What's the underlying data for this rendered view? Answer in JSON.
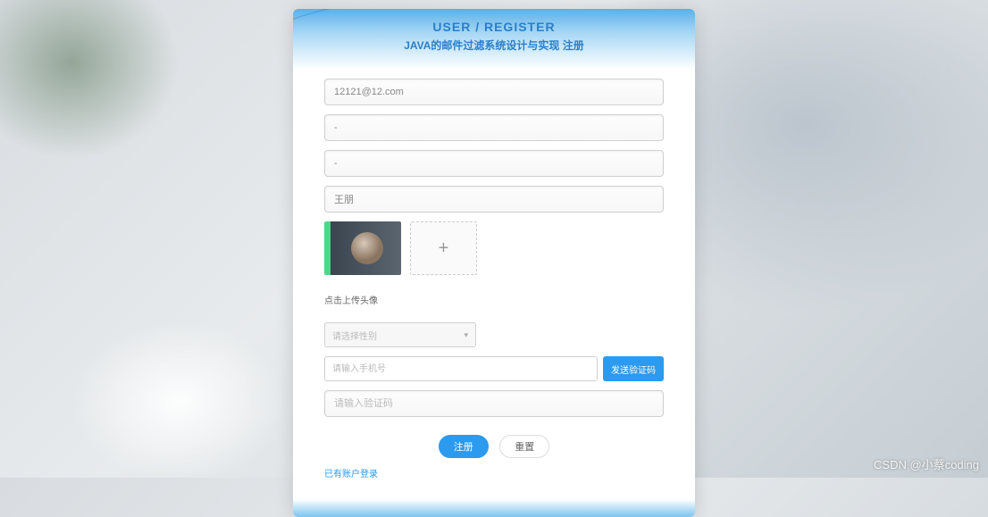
{
  "header": {
    "title": "USER / REGISTER",
    "subtitle": "JAVA的邮件过滤系统设计与实现 注册"
  },
  "form": {
    "email_value": "12121@12.com",
    "password_value": "-",
    "confirm_password_value": "-",
    "realname_value": "王朋",
    "upload_hint": "点击上传头像",
    "gender_placeholder": "请选择性别",
    "phone_placeholder": "请输入手机号",
    "send_code_label": "发送验证码",
    "captcha_placeholder": "请输入验证码"
  },
  "actions": {
    "submit_label": "注册",
    "reset_label": "重置",
    "login_link": "已有账户登录"
  },
  "watermark": "CSDN @小蔡coding"
}
